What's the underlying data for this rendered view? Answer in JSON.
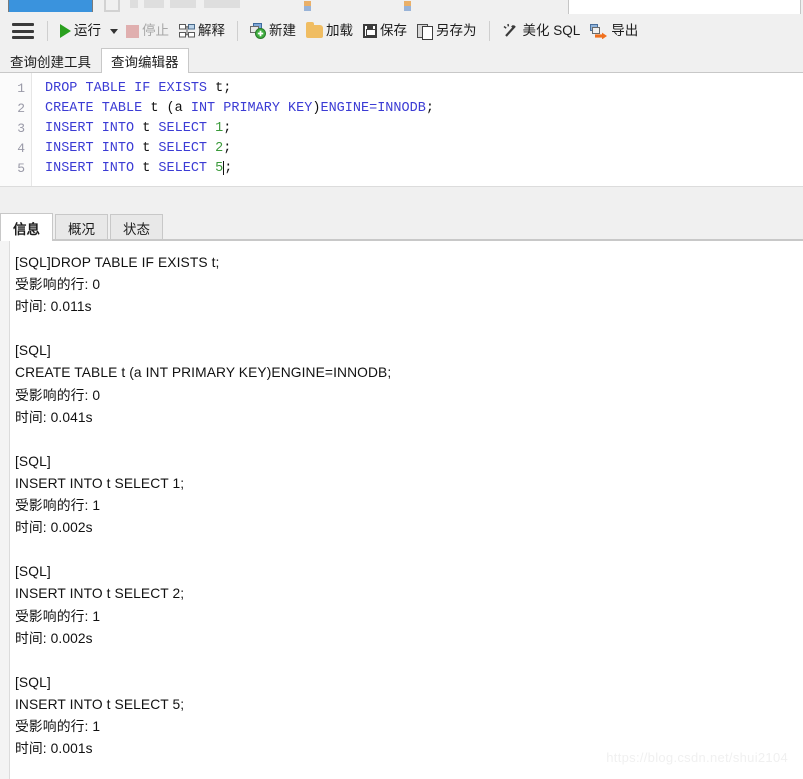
{
  "toolbar": {
    "menu_icon": "hamburger-menu-icon",
    "items": [
      {
        "id": "run",
        "label": "运行",
        "icon": "play-icon",
        "disabled": false,
        "has_dropdown": true
      },
      {
        "id": "stop",
        "label": "停止",
        "icon": "stop-square-icon",
        "disabled": true,
        "has_dropdown": false
      },
      {
        "id": "explain",
        "label": "解释",
        "icon": "explain-plan-icon",
        "disabled": false,
        "has_dropdown": false
      },
      {
        "id": "new",
        "label": "新建",
        "icon": "new-document-icon",
        "disabled": false,
        "has_dropdown": false
      },
      {
        "id": "load",
        "label": "加载",
        "icon": "folder-open-icon",
        "disabled": false,
        "has_dropdown": false
      },
      {
        "id": "save",
        "label": "保存",
        "icon": "floppy-disk-icon",
        "disabled": false,
        "has_dropdown": false
      },
      {
        "id": "save_as",
        "label": "另存为",
        "icon": "save-as-icon",
        "disabled": false,
        "has_dropdown": false
      },
      {
        "id": "beautify",
        "label": "美化 SQL",
        "icon": "magic-wand-icon",
        "disabled": false,
        "has_dropdown": false
      },
      {
        "id": "export",
        "label": "导出",
        "icon": "export-arrow-icon",
        "disabled": false,
        "has_dropdown": false
      }
    ]
  },
  "editor_tabs": [
    {
      "id": "query_builder",
      "label": "查询创建工具",
      "active": false
    },
    {
      "id": "query_editor",
      "label": "查询编辑器",
      "active": true
    }
  ],
  "editor": {
    "line_numbers": [
      "1",
      "2",
      "3",
      "4",
      "5"
    ],
    "lines": [
      {
        "n": "1",
        "tokens": [
          {
            "t": "DROP TABLE IF EXISTS ",
            "c": "kw"
          },
          {
            "t": "t",
            "c": "idn"
          },
          {
            "t": ";",
            "c": "pun"
          }
        ]
      },
      {
        "n": "2",
        "tokens": [
          {
            "t": "CREATE TABLE ",
            "c": "kw"
          },
          {
            "t": "t ",
            "c": "idn"
          },
          {
            "t": "(",
            "c": "pun"
          },
          {
            "t": "a ",
            "c": "idn"
          },
          {
            "t": "INT PRIMARY KEY",
            "c": "kw"
          },
          {
            "t": ")",
            "c": "pun"
          },
          {
            "t": "ENGINE=INNODB",
            "c": "kw"
          },
          {
            "t": ";",
            "c": "pun"
          }
        ]
      },
      {
        "n": "3",
        "tokens": [
          {
            "t": "INSERT INTO ",
            "c": "kw"
          },
          {
            "t": "t ",
            "c": "idn"
          },
          {
            "t": "SELECT ",
            "c": "kw"
          },
          {
            "t": "1",
            "c": "num"
          },
          {
            "t": ";",
            "c": "pun"
          }
        ]
      },
      {
        "n": "4",
        "tokens": [
          {
            "t": "INSERT INTO ",
            "c": "kw"
          },
          {
            "t": "t ",
            "c": "idn"
          },
          {
            "t": "SELECT ",
            "c": "kw"
          },
          {
            "t": "2",
            "c": "num"
          },
          {
            "t": ";",
            "c": "pun"
          }
        ]
      },
      {
        "n": "5",
        "tokens": [
          {
            "t": "INSERT INTO ",
            "c": "kw"
          },
          {
            "t": "t ",
            "c": "idn"
          },
          {
            "t": "SELECT ",
            "c": "kw"
          },
          {
            "t": "5",
            "c": "num"
          },
          {
            "t": "|CARET|",
            "c": "caret"
          },
          {
            "t": ";",
            "c": "pun"
          }
        ]
      }
    ]
  },
  "result_tabs": [
    {
      "id": "info",
      "label": "信息",
      "active": true
    },
    {
      "id": "profile",
      "label": "概况",
      "active": false
    },
    {
      "id": "status",
      "label": "状态",
      "active": false
    }
  ],
  "output": {
    "lines": [
      "[SQL]DROP TABLE IF EXISTS t;",
      "受影响的行: 0",
      "时间: 0.011s",
      "",
      "[SQL]",
      "CREATE TABLE t (a INT PRIMARY KEY)ENGINE=INNODB;",
      "受影响的行: 0",
      "时间: 0.041s",
      "",
      "[SQL]",
      "INSERT INTO t SELECT 1;",
      "受影响的行: 1",
      "时间: 0.002s",
      "",
      "[SQL]",
      "INSERT INTO t SELECT 2;",
      "受影响的行: 1",
      "时间: 0.002s",
      "",
      "[SQL]",
      "INSERT INTO t SELECT 5;",
      "受影响的行: 1",
      "时间: 0.001s"
    ]
  },
  "watermark": {
    "text": "https://blog.csdn.net/shui2104"
  },
  "colors": {
    "accent_blue": "#3a93dd",
    "keyword_blue": "#3b3bd4",
    "number_green": "#3a9a3a",
    "run_green": "#2aa01f",
    "stop_disabled": "#e0afaf",
    "folder_orange": "#f0bd62",
    "export_orange": "#f0701e",
    "toolbar_bg": "#f0f0f0",
    "panel_bg": "#ffffff"
  }
}
